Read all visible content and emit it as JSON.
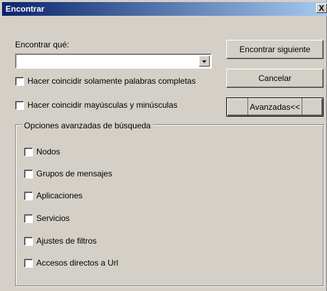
{
  "window": {
    "title": "Encontrar",
    "close_glyph": "X"
  },
  "find": {
    "label": "Encontrar qué:",
    "value": "",
    "options": [
      {
        "label": "Hacer coincidir solamente palabras completas",
        "checked": false
      },
      {
        "label": "Hacer coincidir mayúsculas y minúsculas",
        "checked": false
      }
    ]
  },
  "buttons": {
    "find_next": "Encontrar siguiente",
    "cancel": "Cancelar",
    "advanced": "Avanzadas<<"
  },
  "advanced": {
    "legend": "Opciones avanzadas de búsqueda",
    "items": [
      {
        "label": "Nodos",
        "checked": false
      },
      {
        "label": "Grupos de mensajes",
        "checked": false
      },
      {
        "label": "Aplicaciones",
        "checked": false
      },
      {
        "label": "Servicios",
        "checked": false
      },
      {
        "label": "Ajustes de filtros",
        "checked": false
      },
      {
        "label": "Accesos directos a Url",
        "checked": false
      }
    ]
  }
}
